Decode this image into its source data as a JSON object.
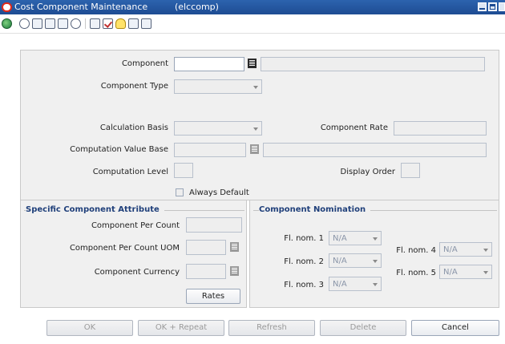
{
  "window": {
    "title": "Cost Component Maintenance",
    "subtitle": "(elccomp)"
  },
  "toolbar": {
    "icons": [
      "globe-icon",
      "help-icon",
      "label-icon",
      "record-icon",
      "print-icon",
      "help2-icon",
      "grid-icon",
      "check-icon",
      "bulb-icon",
      "export-icon",
      "import-icon"
    ]
  },
  "form": {
    "component_label": "Component",
    "component_value": "",
    "component_type_label": "Component Type",
    "component_type_value": "",
    "calculation_basis_label": "Calculation Basis",
    "calculation_basis_value": "",
    "component_rate_label": "Component Rate",
    "computation_value_base_label": "Computation Value Base",
    "computation_level_label": "Computation Level",
    "display_order_label": "Display Order",
    "always_default_label": "Always Default",
    "always_default_checked": false
  },
  "specific_attribute": {
    "title": "Specific Component Attribute",
    "per_count_label": "Component Per Count",
    "per_count_uom_label": "Component Per Count UOM",
    "currency_label": "Component Currency",
    "rates_button": "Rates"
  },
  "nomination": {
    "title": "Component Nomination",
    "fl_nom_1_label": "Fl. nom. 1",
    "fl_nom_1_value": "N/A",
    "fl_nom_2_label": "Fl. nom. 2",
    "fl_nom_2_value": "N/A",
    "fl_nom_3_label": "Fl. nom. 3",
    "fl_nom_3_value": "N/A",
    "fl_nom_4_label": "Fl. nom. 4",
    "fl_nom_4_value": "N/A",
    "fl_nom_5_label": "Fl. nom. 5",
    "fl_nom_5_value": "N/A"
  },
  "buttons": {
    "ok": "OK",
    "ok_repeat": "OK + Repeat",
    "refresh": "Refresh",
    "delete": "Delete",
    "cancel": "Cancel"
  },
  "colors": {
    "titlebar": "#1e4c93",
    "panel": "#f0f0f0",
    "group_title": "#1f3f7a"
  }
}
